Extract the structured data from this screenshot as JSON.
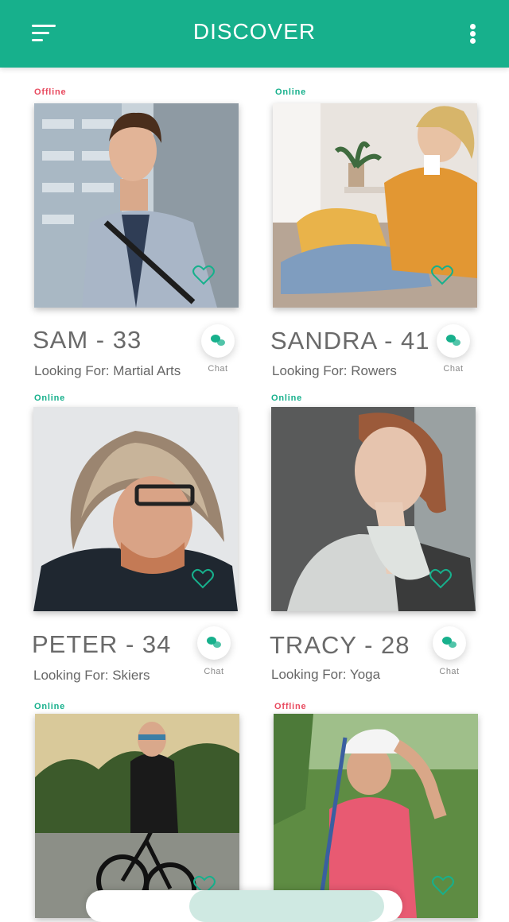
{
  "header": {
    "title": "DISCOVER",
    "menu_icon": "hamburger-menu-icon",
    "more_icon": "more-vertical-icon"
  },
  "colors": {
    "accent": "#17b08c",
    "online": "#17b08c",
    "offline": "#e84a5f",
    "heart": "#17b08c"
  },
  "profiles": [
    {
      "status": "Offline",
      "name": "SAM - 33",
      "looking": "Looking For: Martial Arts",
      "chat": "Chat"
    },
    {
      "status": "Online",
      "name": "SANDRA - 41",
      "looking": "Looking For: Rowers",
      "chat": "Chat"
    },
    {
      "status": "Online",
      "name": "PETER - 34",
      "looking": "Looking For: Skiers",
      "chat": "Chat"
    },
    {
      "status": "Online",
      "name": "TRACY - 28",
      "looking": "Looking For: Yoga",
      "chat": "Chat"
    },
    {
      "status": "Online"
    },
    {
      "status": "Offline"
    }
  ]
}
